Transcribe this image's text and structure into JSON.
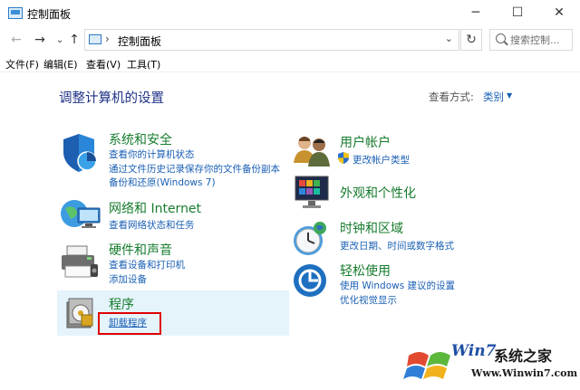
{
  "window": {
    "title": "控制面板",
    "minimize": "─",
    "maximize": "☐",
    "close": "✕"
  },
  "nav": {
    "back": "←",
    "forward": "→",
    "recent": "⌄",
    "up": "↑",
    "refresh": "↻"
  },
  "address": {
    "separator": "›",
    "path": "控制面板",
    "dropdown": "⌄"
  },
  "search": {
    "placeholder": "搜索控制..."
  },
  "menu": {
    "items": [
      "文件(F)",
      "编辑(E)",
      "查看(V)",
      "工具(T)"
    ]
  },
  "page": {
    "title": "调整计算机的设置",
    "view_by_label": "查看方式:",
    "view_by_value": "类别",
    "view_by_caret": "▼"
  },
  "categories_left": [
    {
      "title": "系统和安全",
      "links": [
        "查看你的计算机状态",
        "通过文件历史记录保存你的文件备份副本",
        "备份和还原(Windows 7)"
      ]
    },
    {
      "title": "网络和 Internet",
      "links": [
        "查看网络状态和任务"
      ]
    },
    {
      "title": "硬件和声音",
      "links": [
        "查看设备和打印机",
        "添加设备"
      ]
    },
    {
      "title": "程序",
      "links": [
        "卸载程序"
      ]
    }
  ],
  "categories_right": [
    {
      "title": "用户帐户",
      "links": [
        "更改帐户类型"
      ]
    },
    {
      "title": "外观和个性化",
      "links": []
    },
    {
      "title": "时钟和区域",
      "links": [
        "更改日期、时间或数字格式"
      ]
    },
    {
      "title": "轻松使用",
      "links": [
        "使用 Windows 建议的设置",
        "优化视觉显示"
      ]
    }
  ],
  "watermark": {
    "brand": "Win7",
    "name": "系统之家",
    "site": "Www.Winwin7.com"
  },
  "colors": {
    "category_title": "#177c2e",
    "link": "#1a5fb4",
    "page_title": "#1e3287",
    "highlight_bg": "#e5f3fb",
    "annotation": "#e00000"
  }
}
